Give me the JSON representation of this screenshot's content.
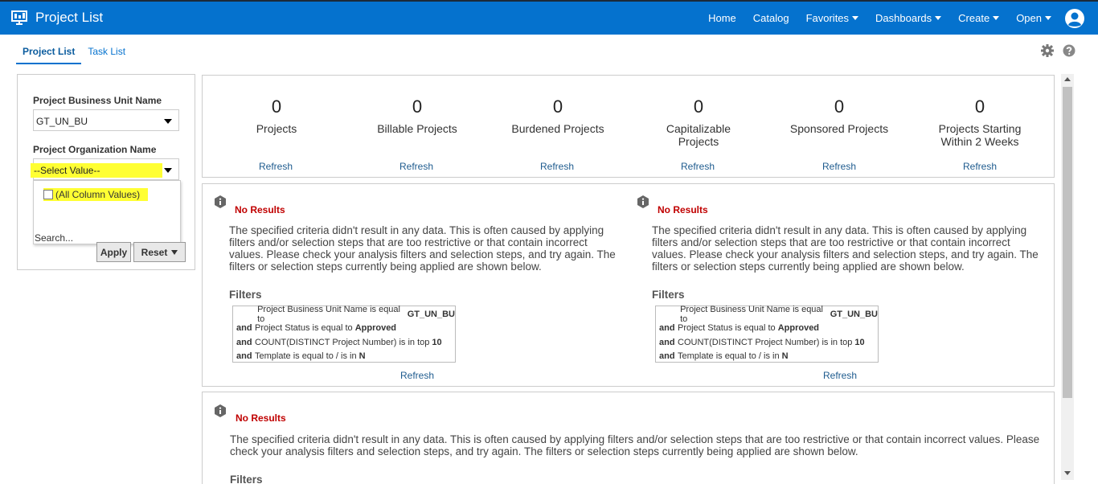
{
  "app": {
    "title": "Project List",
    "nav": [
      {
        "label": "Home",
        "dropdown": false
      },
      {
        "label": "Catalog",
        "dropdown": false
      },
      {
        "label": "Favorites",
        "dropdown": true
      },
      {
        "label": "Dashboards",
        "dropdown": true
      },
      {
        "label": "Create",
        "dropdown": true
      },
      {
        "label": "Open",
        "dropdown": true
      }
    ],
    "header_color": "#0572ce"
  },
  "tabs": [
    {
      "label": "Project List",
      "active": true
    },
    {
      "label": "Task List",
      "active": false
    }
  ],
  "prompts": {
    "bu_label": "Project Business Unit Name",
    "bu_value": "GT_UN_BU",
    "org_label": "Project Organization Name",
    "org_value": "--Select Value--",
    "dropdown_option": "(All Column Values)",
    "search_label": "Search...",
    "apply_label": "Apply",
    "reset_label": "Reset"
  },
  "metrics": [
    {
      "value": "0",
      "label": "Projects"
    },
    {
      "value": "0",
      "label": "Billable Projects"
    },
    {
      "value": "0",
      "label": "Burdened Projects"
    },
    {
      "value": "0",
      "label": "Capitalizable Projects"
    },
    {
      "value": "0",
      "label": "Sponsored Projects"
    },
    {
      "value": "0",
      "label": "Projects Starting Within 2 Weeks"
    }
  ],
  "refresh_label": "Refresh",
  "no_results": {
    "title": "No Results",
    "message": "The specified criteria didn't result in any data. This is often caused by applying filters and/or selection steps that are too restrictive or that contain incorrect values. Please check your analysis filters and selection steps, and try again. The filters or selection steps currently being applied are shown below.",
    "filters_title": "Filters",
    "filters": [
      {
        "prefix": "",
        "text": "Project Business Unit Name is equal to",
        "value": "GT_UN_BU"
      },
      {
        "prefix": "and",
        "text": "Project Status is equal to",
        "value": "Approved"
      },
      {
        "prefix": "and",
        "text": "COUNT(DISTINCT Project Number) is in top",
        "value": "10"
      },
      {
        "prefix": "and",
        "text": "Template is equal to / is in",
        "value": "N"
      }
    ]
  }
}
